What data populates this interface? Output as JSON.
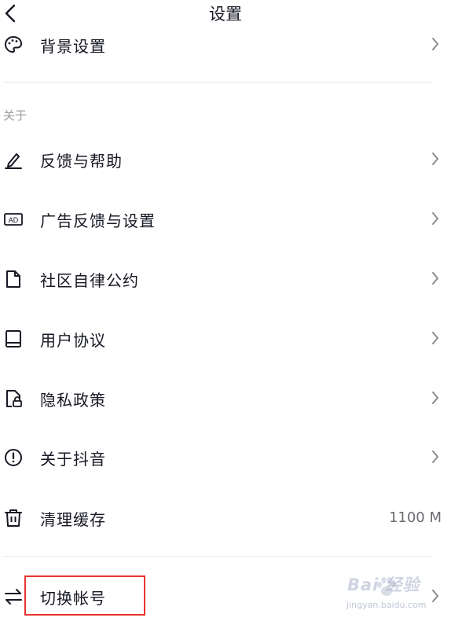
{
  "header": {
    "title": "设置"
  },
  "section_about": "关于",
  "items": [
    {
      "label": "背景设置",
      "icon": "palette-icon"
    },
    {
      "label": "反馈与帮助",
      "icon": "pencil-icon"
    },
    {
      "label": "广告反馈与设置",
      "icon": "ad-icon"
    },
    {
      "label": "社区自律公约",
      "icon": "document-icon"
    },
    {
      "label": "用户协议",
      "icon": "book-icon"
    },
    {
      "label": "隐私政策",
      "icon": "privacy-lock-icon"
    },
    {
      "label": "关于抖音",
      "icon": "info-circle-icon"
    },
    {
      "label": "清理缓存",
      "icon": "trash-icon",
      "value": "1100 M"
    },
    {
      "label": "切换帐号",
      "icon": "swap-arrows-icon"
    }
  ],
  "watermark": {
    "logo": "Bai 经验",
    "url": "jingyan.baidu.com"
  },
  "colors": {
    "highlight": "#e8332e",
    "text": "#161823",
    "secondary": "#9a9ba0"
  }
}
